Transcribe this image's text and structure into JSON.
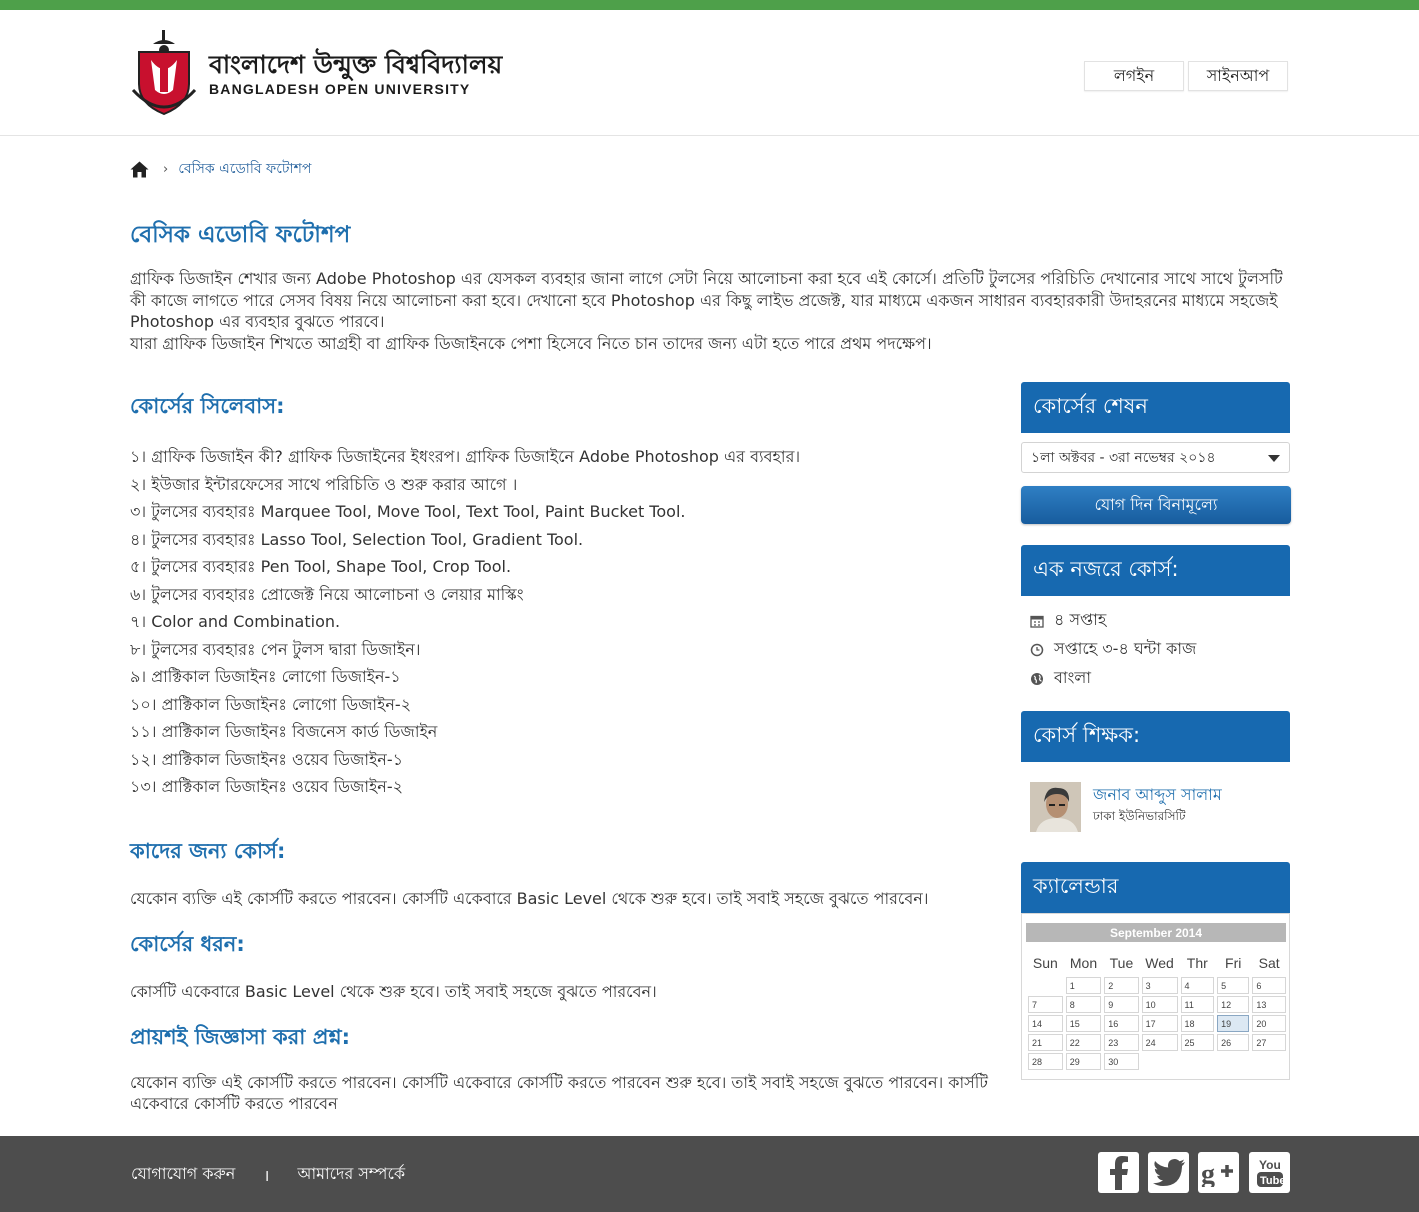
{
  "header": {
    "logo_bn": "বাংলাদেশ উন্মুক্ত বিশ্ববিদ্যালয়",
    "logo_en": "BANGLADESH OPEN UNIVERSITY",
    "login_label": "লগইন",
    "signup_label": "সাইনআপ"
  },
  "breadcrumb": {
    "home_icon": "home-icon",
    "separator": "›",
    "current": "বেসিক এডোবি ফটোশপ"
  },
  "course": {
    "title": "বেসিক এডোবি ফটোশপ",
    "intro_1": "গ্রাফিক ডিজাইন শেখার জন্য Adobe Photoshop এর যেসকল ব্যবহার জানা লাগে সেটা নিয়ে আলোচনা করা হবে এই কোর্সে। প্রতিটি টুলসের পরিচিতি দেখানোর সাথে সাথে টুলসটি কী কাজে লাগতে পারে সেসব বিষয় নিয়ে আলোচনা করা হবে। দেখানো হবে Photoshop এর কিছু লাইভ প্রজেক্ট, যার মাধ্যমে একজন সাধারন ব্যবহারকারী উদাহরনের মাধ্যমে সহজেই Photoshop এর ব্যবহার বুঝতে পারবে।",
    "intro_2": "যারা গ্রাফিক ডিজাইন শিখতে আগ্রহী বা গ্রাফিক ডিজাইনকে পেশা হিসেবে নিতে চান তাদের জন্য এটা হতে পারে প্রথম পদক্ষেপ।"
  },
  "syllabus": {
    "title": "কোর্সের সিলেবাস:",
    "items": [
      "১। গ্রাফিক ডিজাইন কী? গ্রাফিক ডিজাইনের ইধংরপ। গ্রাফিক ডিজাইনে Adobe Photoshop এর ব্যবহার।",
      "২। ইউজার ইন্টারফেসের সাথে পরিচিতি ও শুরু করার আগে ।",
      "৩। টুলসের ব্যবহারঃ Marquee Tool, Move Tool, Text Tool, Paint Bucket Tool.",
      "৪। টুলসের ব্যবহারঃ Lasso Tool, Selection Tool, Gradient Tool.",
      "৫। টুলসের ব্যবহারঃ Pen Tool, Shape Tool, Crop Tool.",
      "৬। টুলসের ব্যবহারঃ  প্রোজেক্ট নিয়ে আলোচনা ও লেয়ার মাস্কিং",
      "৭।  Color and Combination.",
      "৮। টুলসের ব্যবহারঃ পেন টুলস দ্বারা ডিজাইন।",
      "৯। প্রাক্টিকাল ডিজাইনঃ লোগো ডিজাইন-১",
      "১০। প্রাক্টিকাল ডিজাইনঃ লোগো ডিজাইন-২",
      "১১। প্রাক্টিকাল ডিজাইনঃ বিজনেস কার্ড ডিজাইন",
      "১২। প্রাক্টিকাল ডিজাইনঃ ওয়েব ডিজাইন-১",
      "১৩। প্রাক্টিকাল ডিজাইনঃ ওয়েব ডিজাইন-২"
    ]
  },
  "audience": {
    "title": "কাদের জন্য কোর্স:",
    "text": "যেকোন ব্যক্তি এই কোর্সটি করতে পারবেন। কোর্সটি একেবারে Basic Level থেকে শুরু হবে। তাই সবাই সহজে বুঝতে পারবেন।"
  },
  "course_type": {
    "title": "কোর্সের ধরন:",
    "text": "কোর্সটি একেবারে Basic Level থেকে শুরু হবে। তাই সবাই সহজে বুঝতে পারবেন।"
  },
  "faq": {
    "title": "প্রায়শই জিজ্ঞাসা করা প্রশ্ন:",
    "text": "যেকোন ব্যক্তি এই কোর্সটি করতে পারবেন। কোর্সটি একেবারে  কোর্সটি করতে পারবেন শুরু হবে। তাই সবাই সহজে বুঝতে পারবেন। কার্সটি একেবারে  কোর্সটি করতে পারবেন"
  },
  "sidebar": {
    "session_title": "কোর্সের শেষন",
    "session_selected": "১লা অক্টবর - ৩রা নভেম্বর ২০১৪",
    "join_label": "যোগ দিন বিনামূল্যে",
    "glance_title": "এক নজরে কোর্স:",
    "glance_items": [
      {
        "icon": "calendar-icon",
        "text": "৪ সপ্তাহ"
      },
      {
        "icon": "clock-icon",
        "text": "সপ্তাহে ৩-৪ ঘন্টা কাজ"
      },
      {
        "icon": "globe-icon",
        "text": "বাংলা"
      }
    ],
    "teacher_title": "কোর্স শিক্ষক:",
    "teacher_name": "জনাব আব্দুস সালাম",
    "teacher_org": "ঢাকা ইউনিভারসিটি",
    "calendar_title": "ক্যালেন্ডার"
  },
  "calendar": {
    "month": "September 2014",
    "weekdays": [
      "Sun",
      "Mon",
      "Tue",
      "Wed",
      "Thr",
      "Fri",
      "Sat"
    ],
    "weeks": [
      [
        "",
        "1",
        "2",
        "3",
        "4",
        "5",
        "6"
      ],
      [
        "7",
        "8",
        "9",
        "10",
        "11",
        "12",
        "13"
      ],
      [
        "14",
        "15",
        "16",
        "17",
        "18",
        "19",
        "20"
      ],
      [
        "21",
        "22",
        "23",
        "24",
        "25",
        "26",
        "27"
      ],
      [
        "28",
        "29",
        "30",
        "",
        "",
        "",
        ""
      ]
    ],
    "today": "19"
  },
  "footer": {
    "contact": "যোগাযোগ করুন",
    "separator": "।",
    "about": "আমাদের সম্পর্কে",
    "social": [
      "facebook-icon",
      "twitter-icon",
      "google-plus-icon",
      "youtube-icon"
    ]
  },
  "colors": {
    "top_bar": "#4ea04a",
    "accent_blue": "#1769b0",
    "heading_blue": "#1f6fae",
    "footer_bg": "#4d4d4d"
  }
}
